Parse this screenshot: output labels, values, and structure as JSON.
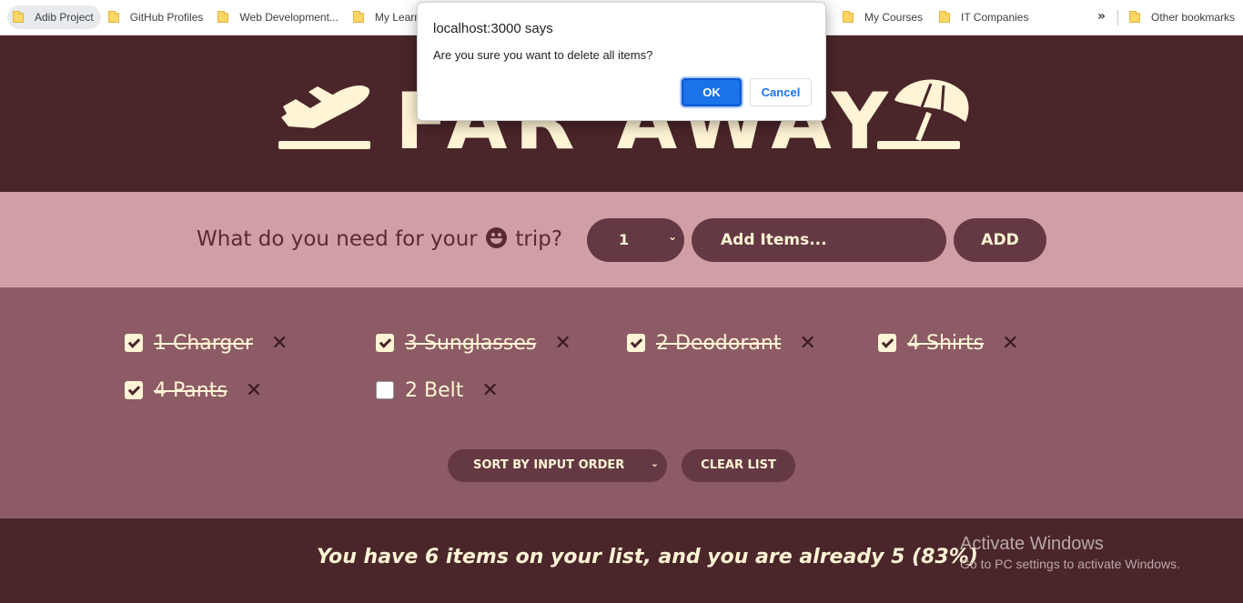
{
  "bookmarks": {
    "items": [
      {
        "label": "Adib Project"
      },
      {
        "label": "GitHub Profiles"
      },
      {
        "label": "Web Development..."
      },
      {
        "label": "My Learn"
      },
      {
        "label": "My Courses"
      },
      {
        "label": "IT Companies"
      }
    ],
    "overflow_icon": "chevron-double-right-icon",
    "other_label": "Other bookmarks"
  },
  "header": {
    "title": "FAR AWAY",
    "left_icon": "airplane-departure-icon",
    "right_icon": "beach-umbrella-icon"
  },
  "form": {
    "question_before": "What do you need for your",
    "question_after": "trip?",
    "emoji_icon": "smiling-face-icon",
    "quantity_value": "1",
    "item_placeholder": "Add Items...",
    "add_label": "ADD"
  },
  "list": {
    "items": [
      {
        "text": "1 Charger",
        "packed": true
      },
      {
        "text": "3 Sunglasses",
        "packed": true
      },
      {
        "text": "2 Deodorant",
        "packed": true
      },
      {
        "text": "4 Shirts",
        "packed": true
      },
      {
        "text": "4 Pants",
        "packed": true
      },
      {
        "text": "2 Belt",
        "packed": false
      }
    ],
    "delete_glyph": "✕",
    "sort_value": "SORT BY INPUT ORDER",
    "clear_label": "CLEAR LIST"
  },
  "stats": {
    "text": "You have 6 items on your list, and you are already 5 (83%)"
  },
  "watermark": {
    "line1": "Activate Windows",
    "line2": "Go to PC settings to activate Windows."
  },
  "dialog": {
    "title": "localhost:3000 says",
    "message": "Are you sure you want to delete all items?",
    "ok_label": "OK",
    "cancel_label": "Cancel"
  },
  "colors": {
    "dark": "#4a2529",
    "cream": "#fff4d5",
    "pink": "#d09fa6",
    "mauve": "#8c5b65",
    "control": "#653943",
    "ok_blue": "#1a73e8"
  }
}
